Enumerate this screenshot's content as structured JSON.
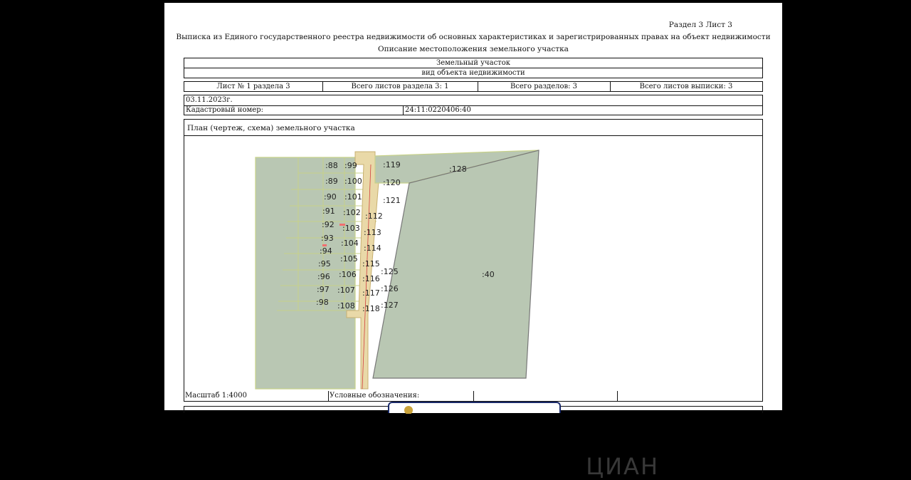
{
  "header": {
    "section_sheet": "Раздел 3   Лист 3",
    "title": "Выписка из Единого государственного реестра недвижимости об основных характеристиках и зарегистрированных правах на объект недвижимости",
    "subtitle": "Описание местоположения земельного участка"
  },
  "object": {
    "type": "Земельный участок",
    "type_caption": "вид объекта недвижимости"
  },
  "sheet_info": {
    "sheet": "Лист № 1 раздела 3",
    "total_section_sheets": "Всего листов раздела 3: 1",
    "total_sections": "Всего разделов: 3",
    "total_extract_sheets": "Всего листов выписки: 3"
  },
  "date": "03.11.2023г.",
  "cadastral": {
    "label": "Кадастровый номер:",
    "value": "24:11:0220406:40"
  },
  "plan": {
    "title": "План (чертеж, схема) земельного участка",
    "parcels": [
      ":88",
      ":99",
      ":119",
      ":128",
      ":89",
      ":100",
      ":120",
      ":90",
      ":101",
      ":121",
      ":91",
      ":102",
      ":112",
      ":92",
      ":103",
      ":113",
      ":93",
      ":104",
      ":114",
      ":94",
      ":105",
      ":115",
      ":95",
      ":106",
      ":116",
      ":125",
      ":40",
      ":96",
      ":107",
      ":117",
      ":126",
      ":97",
      ":108",
      ":118",
      ":127",
      ":98"
    ]
  },
  "footer": {
    "scale": "Масштаб 1:4000",
    "legend": "Условные обозначения:"
  },
  "watermark": "ЦИАН",
  "colors": {
    "parcel_fill": "#b9c7b3",
    "parcel_border": "#c8d28a",
    "road_fill": "#e9d9a8",
    "marker": "#f07070"
  }
}
